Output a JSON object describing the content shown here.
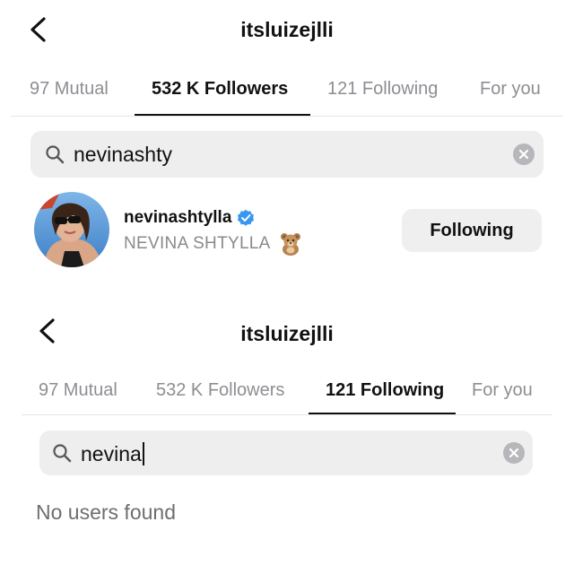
{
  "top": {
    "title": "itsluizejlli",
    "tabs": [
      {
        "label": "97 Mutual",
        "active": false
      },
      {
        "label": "532 K Followers",
        "active": true
      },
      {
        "label": "121 Following",
        "active": false
      },
      {
        "label": "For you",
        "active": false
      }
    ],
    "search": {
      "value": "nevinashty",
      "placeholder": "Search"
    },
    "result": {
      "username": "nevinashtylla",
      "full_name": "NEVINA SHTYLLA",
      "button_label": "Following",
      "verified": true
    }
  },
  "bottom": {
    "title": "itsluizejlli",
    "tabs": [
      {
        "label": "97 Mutual",
        "active": false
      },
      {
        "label": "532 K Followers",
        "active": false
      },
      {
        "label": "121 Following",
        "active": true
      },
      {
        "label": "For you",
        "active": false
      }
    ],
    "search": {
      "value": "nevina",
      "placeholder": "Search"
    },
    "empty_message": "No users found"
  },
  "colors": {
    "verified": "#3897f0",
    "search_bg": "#eeeeef",
    "button_bg": "#efeff0",
    "muted_text": "#8e8e93"
  },
  "icons": [
    "chevron-left-icon",
    "search-icon",
    "clear-icon",
    "verified-badge-icon",
    "teddy-bear-emoji"
  ]
}
